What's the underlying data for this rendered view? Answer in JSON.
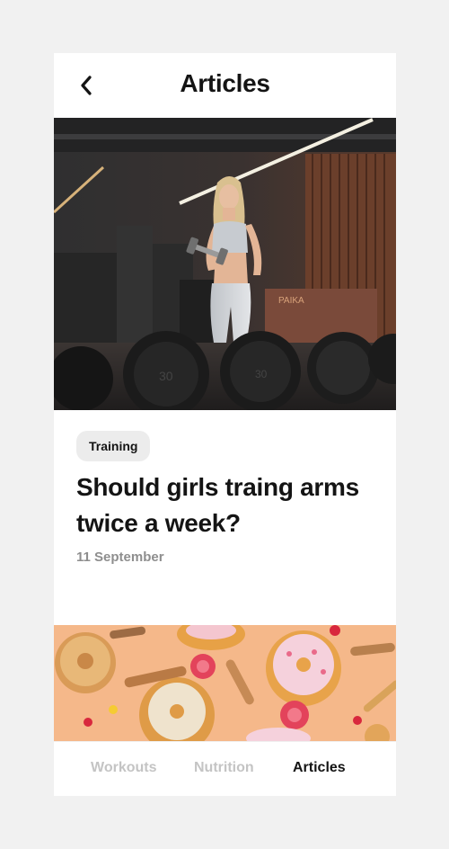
{
  "header": {
    "title": "Articles",
    "back_icon": "chevron-left-icon"
  },
  "article": {
    "image": "gym-woman-dumbbell-photo",
    "tag": "Training",
    "title": "Should girls traing arms twice a week?",
    "date": "11 September"
  },
  "next_article": {
    "image": "donuts-and-candy-photo"
  },
  "tabs": [
    {
      "label": "Workouts",
      "active": false
    },
    {
      "label": "Nutrition",
      "active": false
    },
    {
      "label": "Articles",
      "active": true
    }
  ],
  "colors": {
    "background": "#f1f1f1",
    "text_primary": "#141414",
    "text_muted": "#8e8e8e",
    "tab_inactive": "#c4c4c4",
    "tag_bg": "#ececec"
  }
}
